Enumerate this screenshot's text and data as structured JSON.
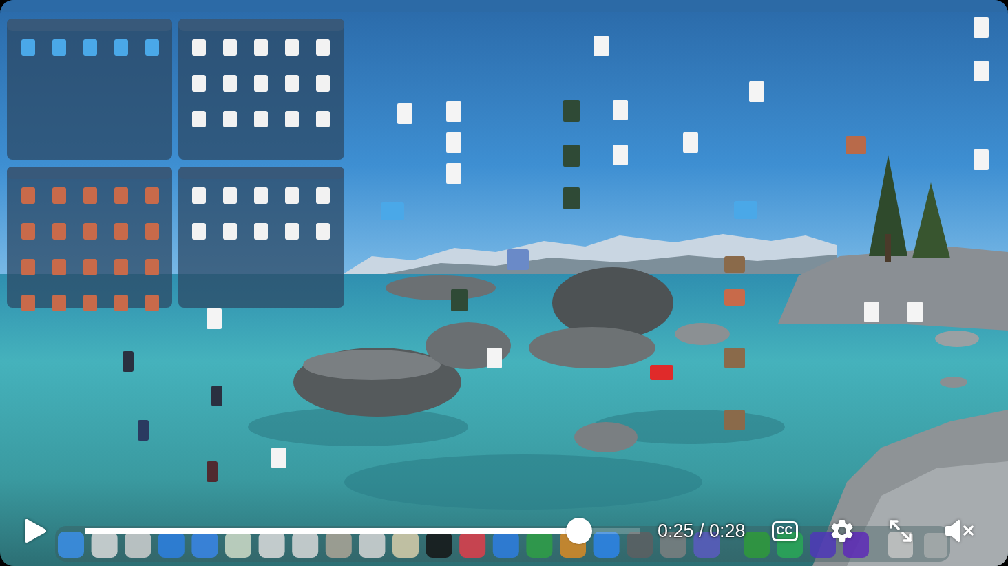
{
  "player": {
    "playing": false,
    "progress": {
      "level": 0.89
    },
    "time": "0:25 / 0:28",
    "captions_label": "CC",
    "muted": true
  }
}
